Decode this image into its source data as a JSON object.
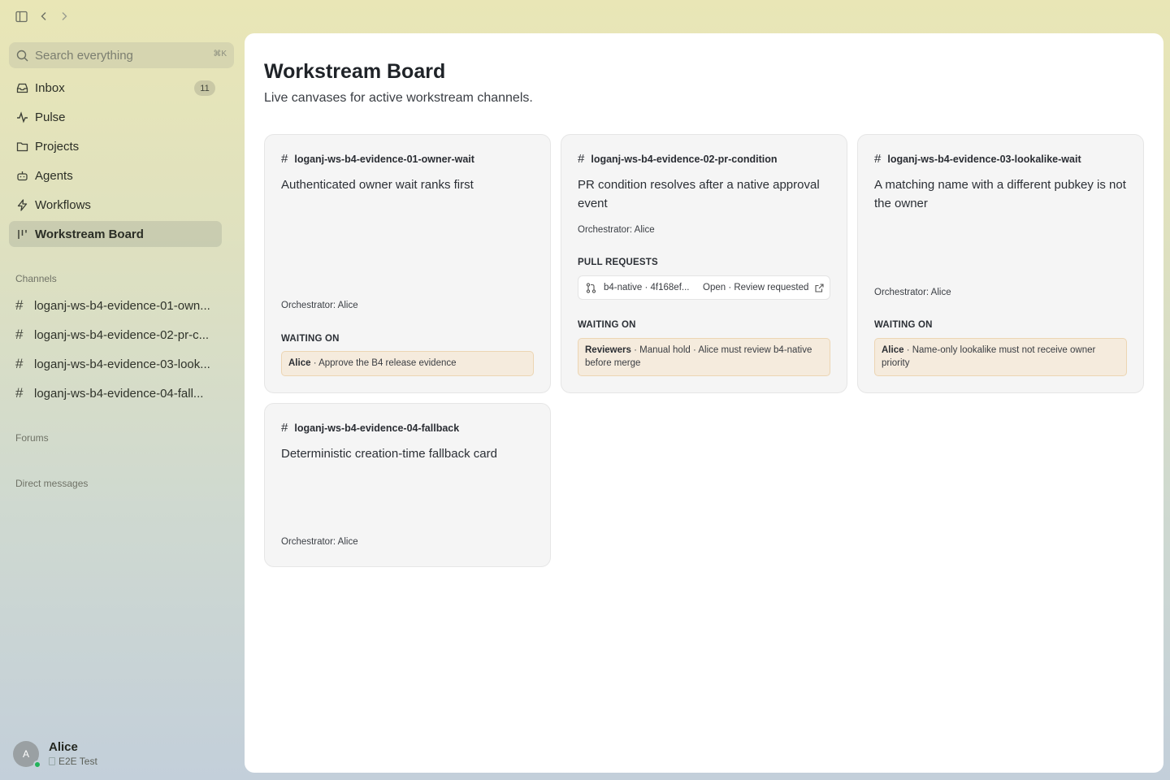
{
  "sidebar": {
    "search": {
      "placeholder": "Search everything",
      "shortcut": "⌘K"
    },
    "nav": [
      {
        "label": "Inbox",
        "badge": "11",
        "icon": "inbox-icon"
      },
      {
        "label": "Pulse",
        "icon": "pulse-icon"
      },
      {
        "label": "Projects",
        "icon": "folder-icon"
      },
      {
        "label": "Agents",
        "icon": "agents-icon"
      },
      {
        "label": "Workflows",
        "icon": "bolt-icon"
      },
      {
        "label": "Workstream Board",
        "icon": "board-icon",
        "active": true
      }
    ],
    "channels_label": "Channels",
    "channels": [
      {
        "label": "loganj-ws-b4-evidence-01-own..."
      },
      {
        "label": "loganj-ws-b4-evidence-02-pr-c..."
      },
      {
        "label": "loganj-ws-b4-evidence-03-look..."
      },
      {
        "label": "loganj-ws-b4-evidence-04-fall..."
      }
    ],
    "forums_label": "Forums",
    "dm_label": "Direct messages",
    "user": {
      "initial": "A",
      "name": "Alice",
      "subtitle": "E2E Test"
    }
  },
  "main": {
    "title": "Workstream Board",
    "subtitle": "Live canvases for active workstream channels.",
    "cards": [
      {
        "channel": "loganj-ws-b4-evidence-01-owner-wait",
        "title": "Authenticated owner wait ranks first",
        "orchestrator": "Orchestrator: Alice",
        "waiting_label": "WAITING ON",
        "waiting_who": "Alice",
        "waiting_text": " · Approve the B4 release evidence"
      },
      {
        "channel": "loganj-ws-b4-evidence-02-pr-condition",
        "title": "PR condition resolves after a native approval event",
        "orchestrator": "Orchestrator: Alice",
        "pr_label": "PULL REQUESTS",
        "pr_ref": "b4-native · 4f168ef...",
        "pr_state": "Open · Review requested",
        "waiting_label": "WAITING ON",
        "waiting_who": "Reviewers",
        "waiting_text": " · Manual hold · Alice must review b4-native before merge"
      },
      {
        "channel": "loganj-ws-b4-evidence-03-lookalike-wait",
        "title": "A matching name with a different pubkey is not the owner",
        "orchestrator": "Orchestrator: Alice",
        "waiting_label": "WAITING ON",
        "waiting_who": "Alice",
        "waiting_text": " · Name-only lookalike must not receive owner priority"
      },
      {
        "channel": "loganj-ws-b4-evidence-04-fallback",
        "title": "Deterministic creation-time fallback card",
        "orchestrator": "Orchestrator: Alice"
      }
    ]
  }
}
